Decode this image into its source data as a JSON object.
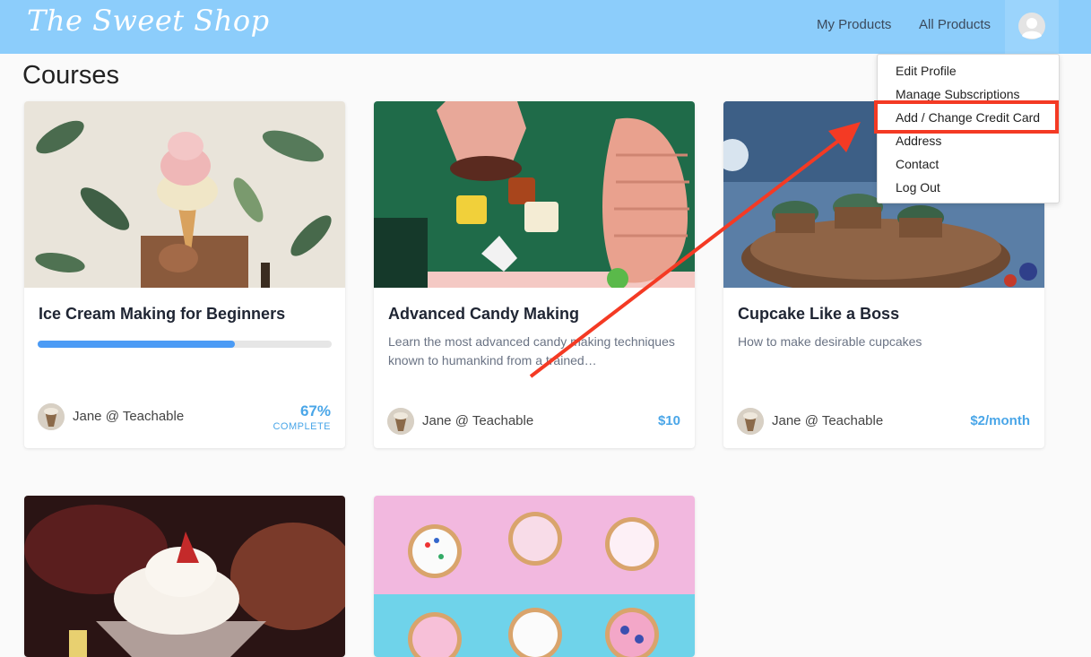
{
  "header": {
    "logo_text": "The Sweet Shop",
    "nav": [
      {
        "label": "My Products"
      },
      {
        "label": "All Products"
      }
    ]
  },
  "page": {
    "title": "Courses"
  },
  "dropdown": {
    "items": [
      {
        "label": "Edit Profile"
      },
      {
        "label": "Manage Subscriptions"
      },
      {
        "label": "Add / Change Credit Card"
      },
      {
        "label": "Address"
      },
      {
        "label": "Contact"
      },
      {
        "label": "Log Out"
      }
    ],
    "highlighted_index": 2
  },
  "courses": [
    {
      "title": "Ice Cream Making for Beginners",
      "description": "",
      "author": "Jane @ Teachable",
      "progress_percent": 67,
      "progress_text": "67%",
      "progress_label": "COMPLETE"
    },
    {
      "title": "Advanced Candy Making",
      "description": "Learn the most advanced candy making techniques known to humankind from a trained…",
      "author": "Jane @ Teachable",
      "price": "$10"
    },
    {
      "title": "Cupcake Like a Boss",
      "description": "How to make desirable cupcakes",
      "author": "Jane @ Teachable",
      "price": "$2/month"
    },
    {
      "title": ""
    },
    {
      "title": ""
    }
  ],
  "colors": {
    "navbar": "#8ccdfb",
    "accent": "#4aa6e8",
    "progress": "#4b9bf5",
    "annotation": "#f43a24"
  }
}
